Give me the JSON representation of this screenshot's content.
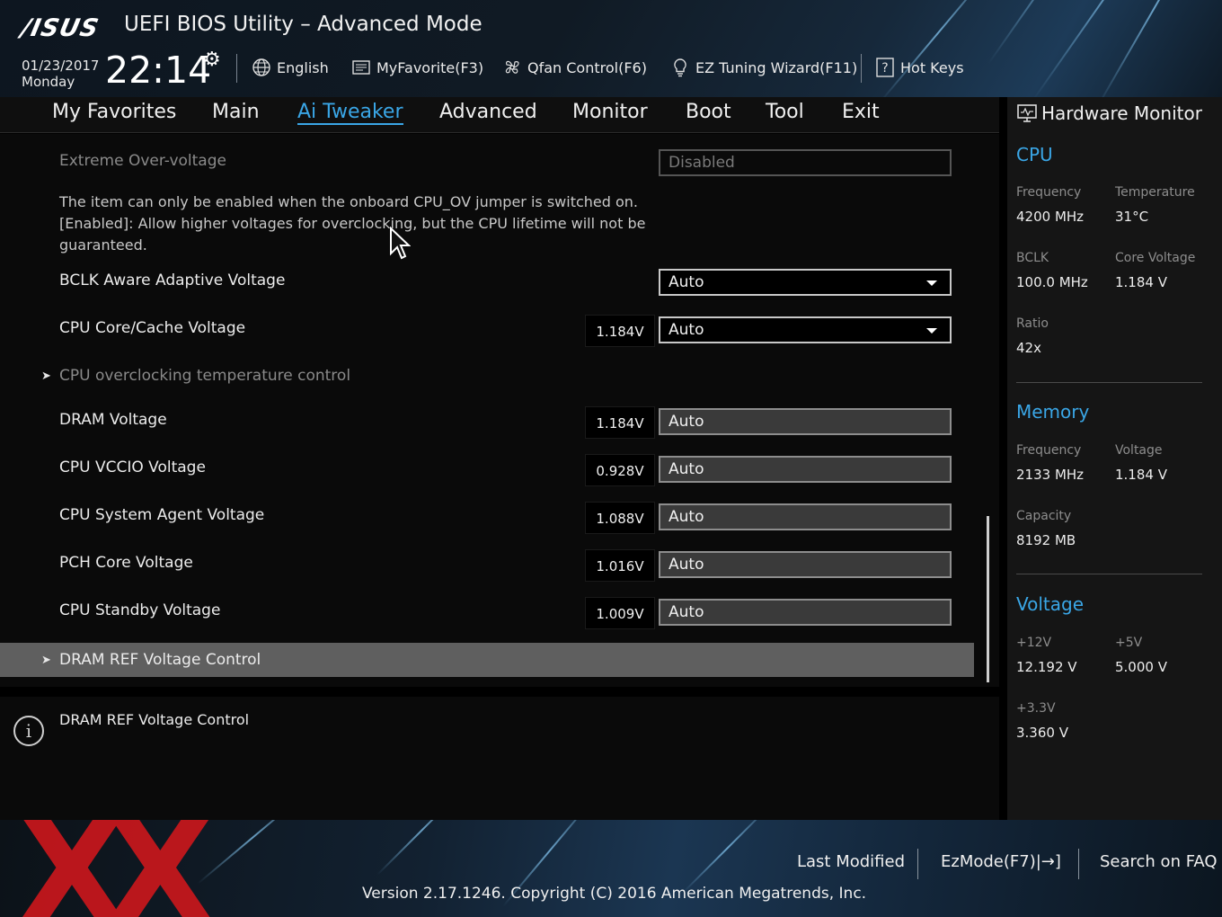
{
  "header": {
    "logo": "/ISUS",
    "title": "UEFI BIOS Utility – Advanced Mode",
    "date": "01/23/2017",
    "day": "Monday",
    "time": "22:14",
    "toolbar": {
      "language": "English",
      "favorite": "MyFavorite(F3)",
      "qfan": "Qfan Control(F6)",
      "ez_tuning": "EZ Tuning Wizard(F11)",
      "hotkeys": "Hot Keys"
    }
  },
  "tabs": [
    "My Favorites",
    "Main",
    "Ai Tweaker",
    "Advanced",
    "Monitor",
    "Boot",
    "Tool",
    "Exit"
  ],
  "active_tab": "Ai Tweaker",
  "settings": {
    "extreme_ov": {
      "label": "Extreme Over-voltage",
      "value": "Disabled"
    },
    "help_text": "The item can only be enabled when the onboard CPU_OV jumper is switched on. [Enabled]: Allow higher voltages for overclocking, but the CPU lifetime will not be guaranteed.",
    "bclk_aware": {
      "label": "BCLK Aware Adaptive Voltage",
      "value": "Auto"
    },
    "cpu_core_cache": {
      "label": "CPU Core/Cache Voltage",
      "reading": "1.184V",
      "value": "Auto"
    },
    "cpu_oc_temp": {
      "label": "CPU overclocking temperature control"
    },
    "dram_voltage": {
      "label": "DRAM Voltage",
      "reading": "1.184V",
      "value": "Auto"
    },
    "cpu_vccio": {
      "label": "CPU VCCIO Voltage",
      "reading": "0.928V",
      "value": "Auto"
    },
    "cpu_sa": {
      "label": "CPU System Agent Voltage",
      "reading": "1.088V",
      "value": "Auto"
    },
    "pch_core": {
      "label": "PCH Core Voltage",
      "reading": "1.016V",
      "value": "Auto"
    },
    "cpu_standby": {
      "label": "CPU Standby Voltage",
      "reading": "1.009V",
      "value": "Auto"
    },
    "dram_ref": {
      "label": "DRAM REF Voltage Control"
    }
  },
  "info": {
    "text": "DRAM REF Voltage Control"
  },
  "hardware_monitor": {
    "title": "Hardware Monitor",
    "cpu": {
      "heading": "CPU",
      "frequency_label": "Frequency",
      "frequency": "4200 MHz",
      "temperature_label": "Temperature",
      "temperature": "31°C",
      "bclk_label": "BCLK",
      "bclk": "100.0 MHz",
      "core_voltage_label": "Core Voltage",
      "core_voltage": "1.184 V",
      "ratio_label": "Ratio",
      "ratio": "42x"
    },
    "memory": {
      "heading": "Memory",
      "frequency_label": "Frequency",
      "frequency": "2133 MHz",
      "voltage_label": "Voltage",
      "voltage": "1.184 V",
      "capacity_label": "Capacity",
      "capacity": "8192 MB"
    },
    "voltage": {
      "heading": "Voltage",
      "v12_label": "+12V",
      "v12": "12.192 V",
      "v5_label": "+5V",
      "v5": "5.000 V",
      "v33_label": "+3.3V",
      "v33": "3.360 V"
    }
  },
  "footer": {
    "last_modified": "Last Modified",
    "ezmode": "EzMode(F7)|→]",
    "search_faq": "Search on FAQ",
    "version": "Version 2.17.1246. Copyright (C) 2016 American Megatrends, Inc."
  },
  "watermark": "XX",
  "colors": {
    "accent": "#3aa6e6",
    "highlight_row": "#5f5f5f",
    "watermark": "#c8171c"
  }
}
